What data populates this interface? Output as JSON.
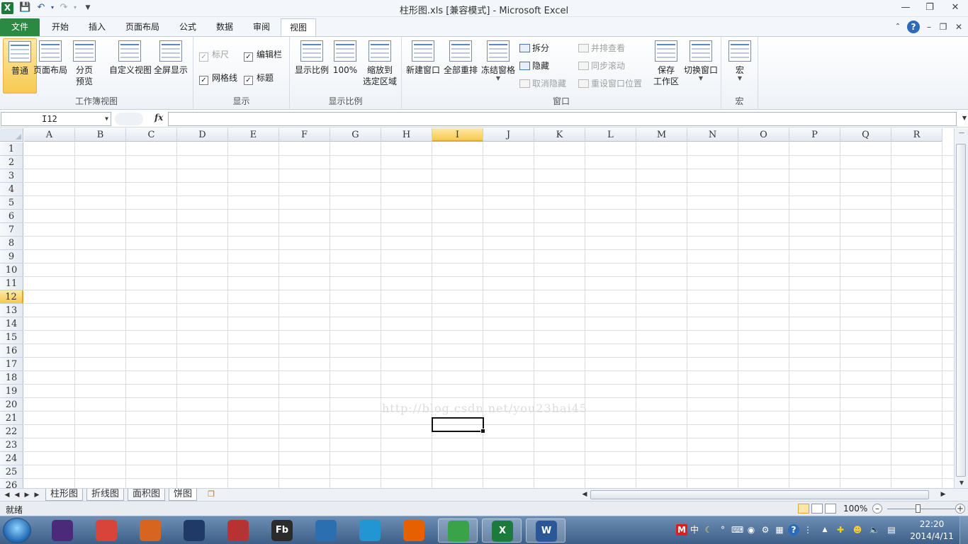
{
  "window": {
    "title": "柱形图.xls  [兼容模式] - Microsoft Excel",
    "app_icon_letter": "X"
  },
  "ribbon_tabs": [
    {
      "label": "文件"
    },
    {
      "label": "开始"
    },
    {
      "label": "插入"
    },
    {
      "label": "页面布局"
    },
    {
      "label": "公式"
    },
    {
      "label": "数据"
    },
    {
      "label": "审阅"
    },
    {
      "label": "视图"
    }
  ],
  "ribbon": {
    "workbook_views": {
      "label": "工作簿视图",
      "normal": "普通",
      "page_layout": "页面布局",
      "page_break_1": "分页",
      "page_break_2": "预览",
      "custom_views": "自定义视图",
      "full_screen": "全屏显示"
    },
    "show": {
      "label": "显示",
      "ruler": "标尺",
      "formula_bar": "编辑栏",
      "gridlines": "网格线",
      "headings": "标题"
    },
    "zoom": {
      "label": "显示比例",
      "zoom": "显示比例",
      "hundred": "100%",
      "to_selection_1": "缩放到",
      "to_selection_2": "选定区域"
    },
    "window": {
      "label": "窗口",
      "new_window": "新建窗口",
      "arrange_all": "全部重排",
      "freeze_panes": "冻结窗格",
      "split": "拆分",
      "hide": "隐藏",
      "unhide": "取消隐藏",
      "side_by_side": "并排查看",
      "sync_scroll": "同步滚动",
      "reset_position": "重设窗口位置",
      "save_workspace_1": "保存",
      "save_workspace_2": "工作区",
      "switch_windows": "切换窗口"
    },
    "macros": {
      "label": "宏",
      "macros": "宏"
    }
  },
  "formula_bar": {
    "name_box": "I12",
    "fx": "fx",
    "value": ""
  },
  "grid": {
    "columns": [
      "A",
      "B",
      "C",
      "D",
      "E",
      "F",
      "G",
      "H",
      "I",
      "J",
      "K",
      "L",
      "M",
      "N",
      "O",
      "P",
      "Q",
      "R"
    ],
    "rows": [
      "1",
      "2",
      "3",
      "4",
      "5",
      "6",
      "7",
      "8",
      "9",
      "10",
      "11",
      "12",
      "13",
      "14",
      "15",
      "16",
      "17",
      "18",
      "19",
      "20",
      "21",
      "22",
      "23",
      "24",
      "25",
      "26"
    ],
    "selected_column": "I",
    "selected_row": "12",
    "watermark": "http://blog.csdn.net/you23hai45"
  },
  "sheets": [
    {
      "label": "柱形图"
    },
    {
      "label": "折线图"
    },
    {
      "label": "面积图"
    },
    {
      "label": "饼图"
    }
  ],
  "active_sheet": "饼图",
  "status": {
    "text": "就绪",
    "zoom": "100%"
  },
  "taskbar": {
    "apps": [
      {
        "name": "eclipse",
        "color": "#4b2a7a"
      },
      {
        "name": "notes",
        "color": "#d9443a"
      },
      {
        "name": "matlab",
        "color": "#d8651f"
      },
      {
        "name": "sublime",
        "color": "#1f3a66"
      },
      {
        "name": "tool",
        "color": "#b73333"
      },
      {
        "name": "fb",
        "color": "#2b2b2b",
        "label": "Fb"
      },
      {
        "name": "cube",
        "color": "#2c6fb0"
      },
      {
        "name": "cloud",
        "color": "#2196d3"
      },
      {
        "name": "firefox",
        "color": "#e66000"
      },
      {
        "name": "ie",
        "color": "#3aa34a"
      },
      {
        "name": "excel",
        "color": "#1d7a3d",
        "label": "X"
      },
      {
        "name": "word",
        "color": "#2b5797",
        "label": "W"
      }
    ],
    "clock_time": "22:20",
    "clock_date": "2014/4/11",
    "ime": "中"
  }
}
